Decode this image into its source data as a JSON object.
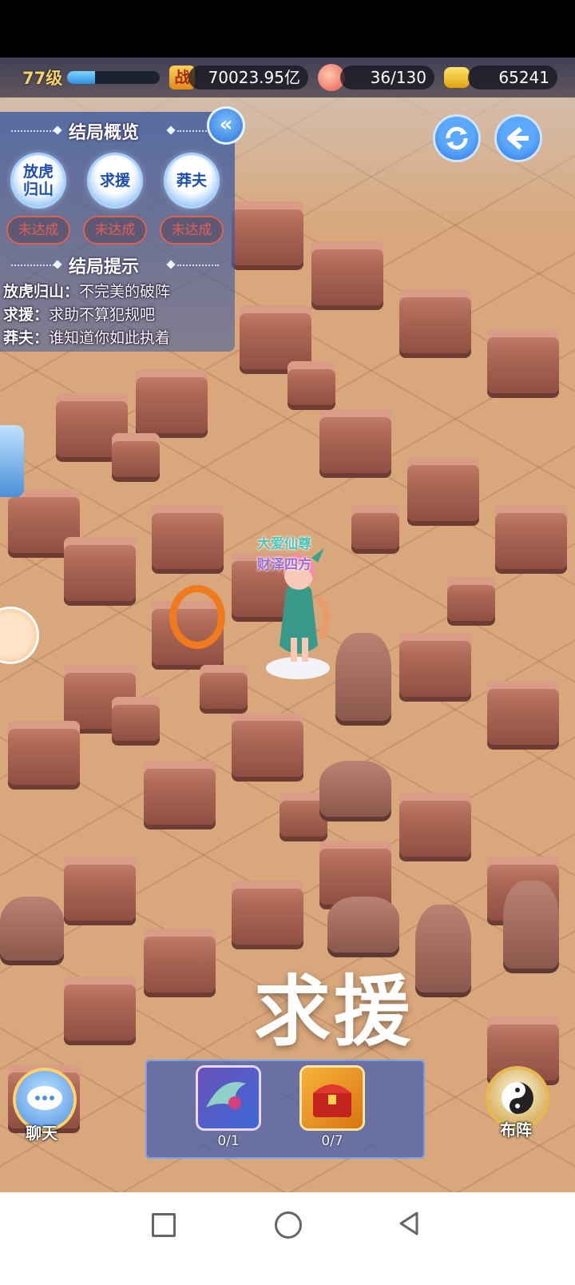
{
  "hud": {
    "level": "77级",
    "level_progress": 0.3,
    "power_badge": "战",
    "power": "70023.95亿",
    "stamina": "36/130",
    "gold": "65241"
  },
  "overview": {
    "title": "结局概览",
    "endings": [
      {
        "name_line1": "放虎",
        "name_line2": "归山",
        "status": "未达成"
      },
      {
        "name_line1": "求援",
        "name_line2": "",
        "status": "未达成"
      },
      {
        "name_line1": "莽夫",
        "name_line2": "",
        "status": "未达成"
      }
    ],
    "tips_title": "结局提示",
    "tips": [
      {
        "label": "放虎归山：",
        "text": "不完美的破阵"
      },
      {
        "label": "求援：",
        "text": "求助不算犯规吧"
      },
      {
        "label": "莽夫：",
        "text": "谁知道你如此执着"
      }
    ]
  },
  "character": {
    "title1": "大爱仙尊",
    "title2": "财泽四方",
    "title1_color": "#4fc3b8",
    "title2_color": "#9b6bd6"
  },
  "overlay_text": "求援",
  "items": [
    {
      "count": "0/1"
    },
    {
      "count": "0/7"
    }
  ],
  "buttons": {
    "chat": "聊天",
    "formation": "布阵"
  },
  "colors": {
    "accent_blue": "#2e8fe0",
    "status_red": "#e0604e",
    "marker_orange": "#f07a1e"
  }
}
